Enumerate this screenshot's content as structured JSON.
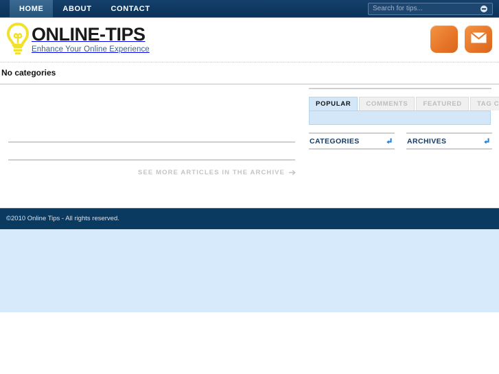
{
  "topnav": {
    "items": [
      {
        "label": "HOME",
        "active": true
      },
      {
        "label": "ABOUT",
        "active": false
      },
      {
        "label": "CONTACT",
        "active": false
      }
    ]
  },
  "search": {
    "placeholder": "Search for tips...",
    "value": "",
    "button_icon": "search-submit-icon"
  },
  "branding": {
    "logo_icon": "lightbulb-icon",
    "title": "ONLINE-TIPS",
    "tagline": "Enhance Your Online Experience",
    "accent_color": "#f2e12a",
    "title_color": "#1a1a1a",
    "tagline_color": "#3f5f8a"
  },
  "social": {
    "buttons": [
      {
        "icon": "rss-icon",
        "label": ""
      },
      {
        "icon": "envelope-icon",
        "label": ""
      }
    ],
    "color": "#e8772a"
  },
  "categories_strip": {
    "label": "No categories"
  },
  "content": {
    "see_more_label": "SEE MORE ARTICLES IN THE ARCHIVE",
    "see_more_icon": "arrow-right-icon"
  },
  "sidebar": {
    "tabs": [
      {
        "label": "POPULAR",
        "active": true
      },
      {
        "label": "COMMENTS",
        "active": false
      },
      {
        "label": "FEATURED",
        "active": false
      },
      {
        "label": "TAG CLOUD",
        "active": false
      }
    ],
    "widgets": [
      {
        "title": "CATEGORIES",
        "toggle_icon": "collapse-arrow-icon"
      },
      {
        "title": "ARCHIVES",
        "toggle_icon": "collapse-arrow-icon"
      }
    ],
    "panel_color": "#d3e7f8"
  },
  "footer": {
    "copyright": "©2010 Online Tips - All rights reserved.",
    "background": "#0b3a61"
  }
}
